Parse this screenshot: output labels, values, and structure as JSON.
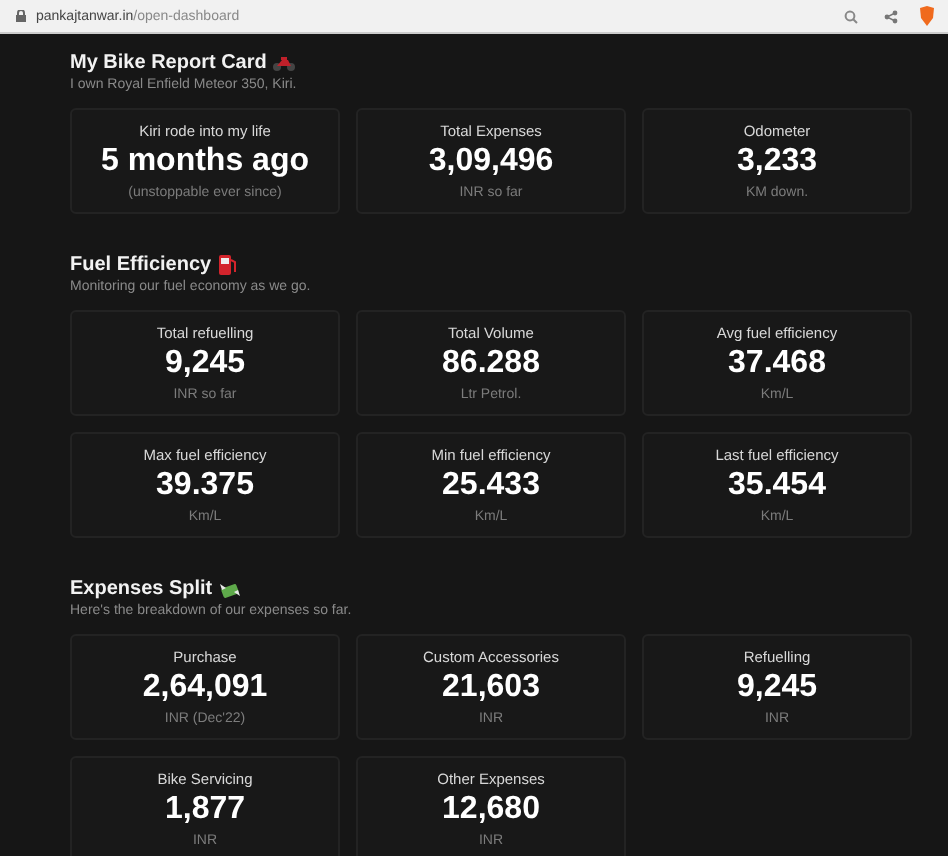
{
  "address_bar": {
    "host": "pankajtanwar.in",
    "path": "/open-dashboard"
  },
  "sections": [
    {
      "title": "My Bike Report Card",
      "subtitle": "I own Royal Enfield Meteor 350, Kiri.",
      "cards": [
        {
          "label": "Kiri rode into my life",
          "value": "5 months ago",
          "caption": "(unstoppable ever since)"
        },
        {
          "label": "Total Expenses",
          "value": "3,09,496",
          "caption": "INR so far"
        },
        {
          "label": "Odometer",
          "value": "3,233",
          "caption": "KM down."
        }
      ]
    },
    {
      "title": "Fuel Efficiency",
      "subtitle": "Monitoring our fuel economy as we go.",
      "cards": [
        {
          "label": "Total refuelling",
          "value": "9,245",
          "caption": "INR so far"
        },
        {
          "label": "Total Volume",
          "value": "86.288",
          "caption": "Ltr Petrol."
        },
        {
          "label": "Avg fuel efficiency",
          "value": "37.468",
          "caption": "Km/L"
        },
        {
          "label": "Max fuel efficiency",
          "value": "39.375",
          "caption": "Km/L"
        },
        {
          "label": "Min fuel efficiency",
          "value": "25.433",
          "caption": "Km/L"
        },
        {
          "label": "Last fuel efficiency",
          "value": "35.454",
          "caption": "Km/L"
        }
      ]
    },
    {
      "title": "Expenses Split",
      "subtitle": "Here's the breakdown of our expenses so far.",
      "cards": [
        {
          "label": "Purchase",
          "value": "2,64,091",
          "caption": "INR (Dec'22)"
        },
        {
          "label": "Custom Accessories",
          "value": "21,603",
          "caption": "INR"
        },
        {
          "label": "Refuelling",
          "value": "9,245",
          "caption": "INR"
        },
        {
          "label": "Bike Servicing",
          "value": "1,877",
          "caption": "INR"
        },
        {
          "label": "Other Expenses",
          "value": "12,680",
          "caption": "INR"
        }
      ]
    }
  ]
}
